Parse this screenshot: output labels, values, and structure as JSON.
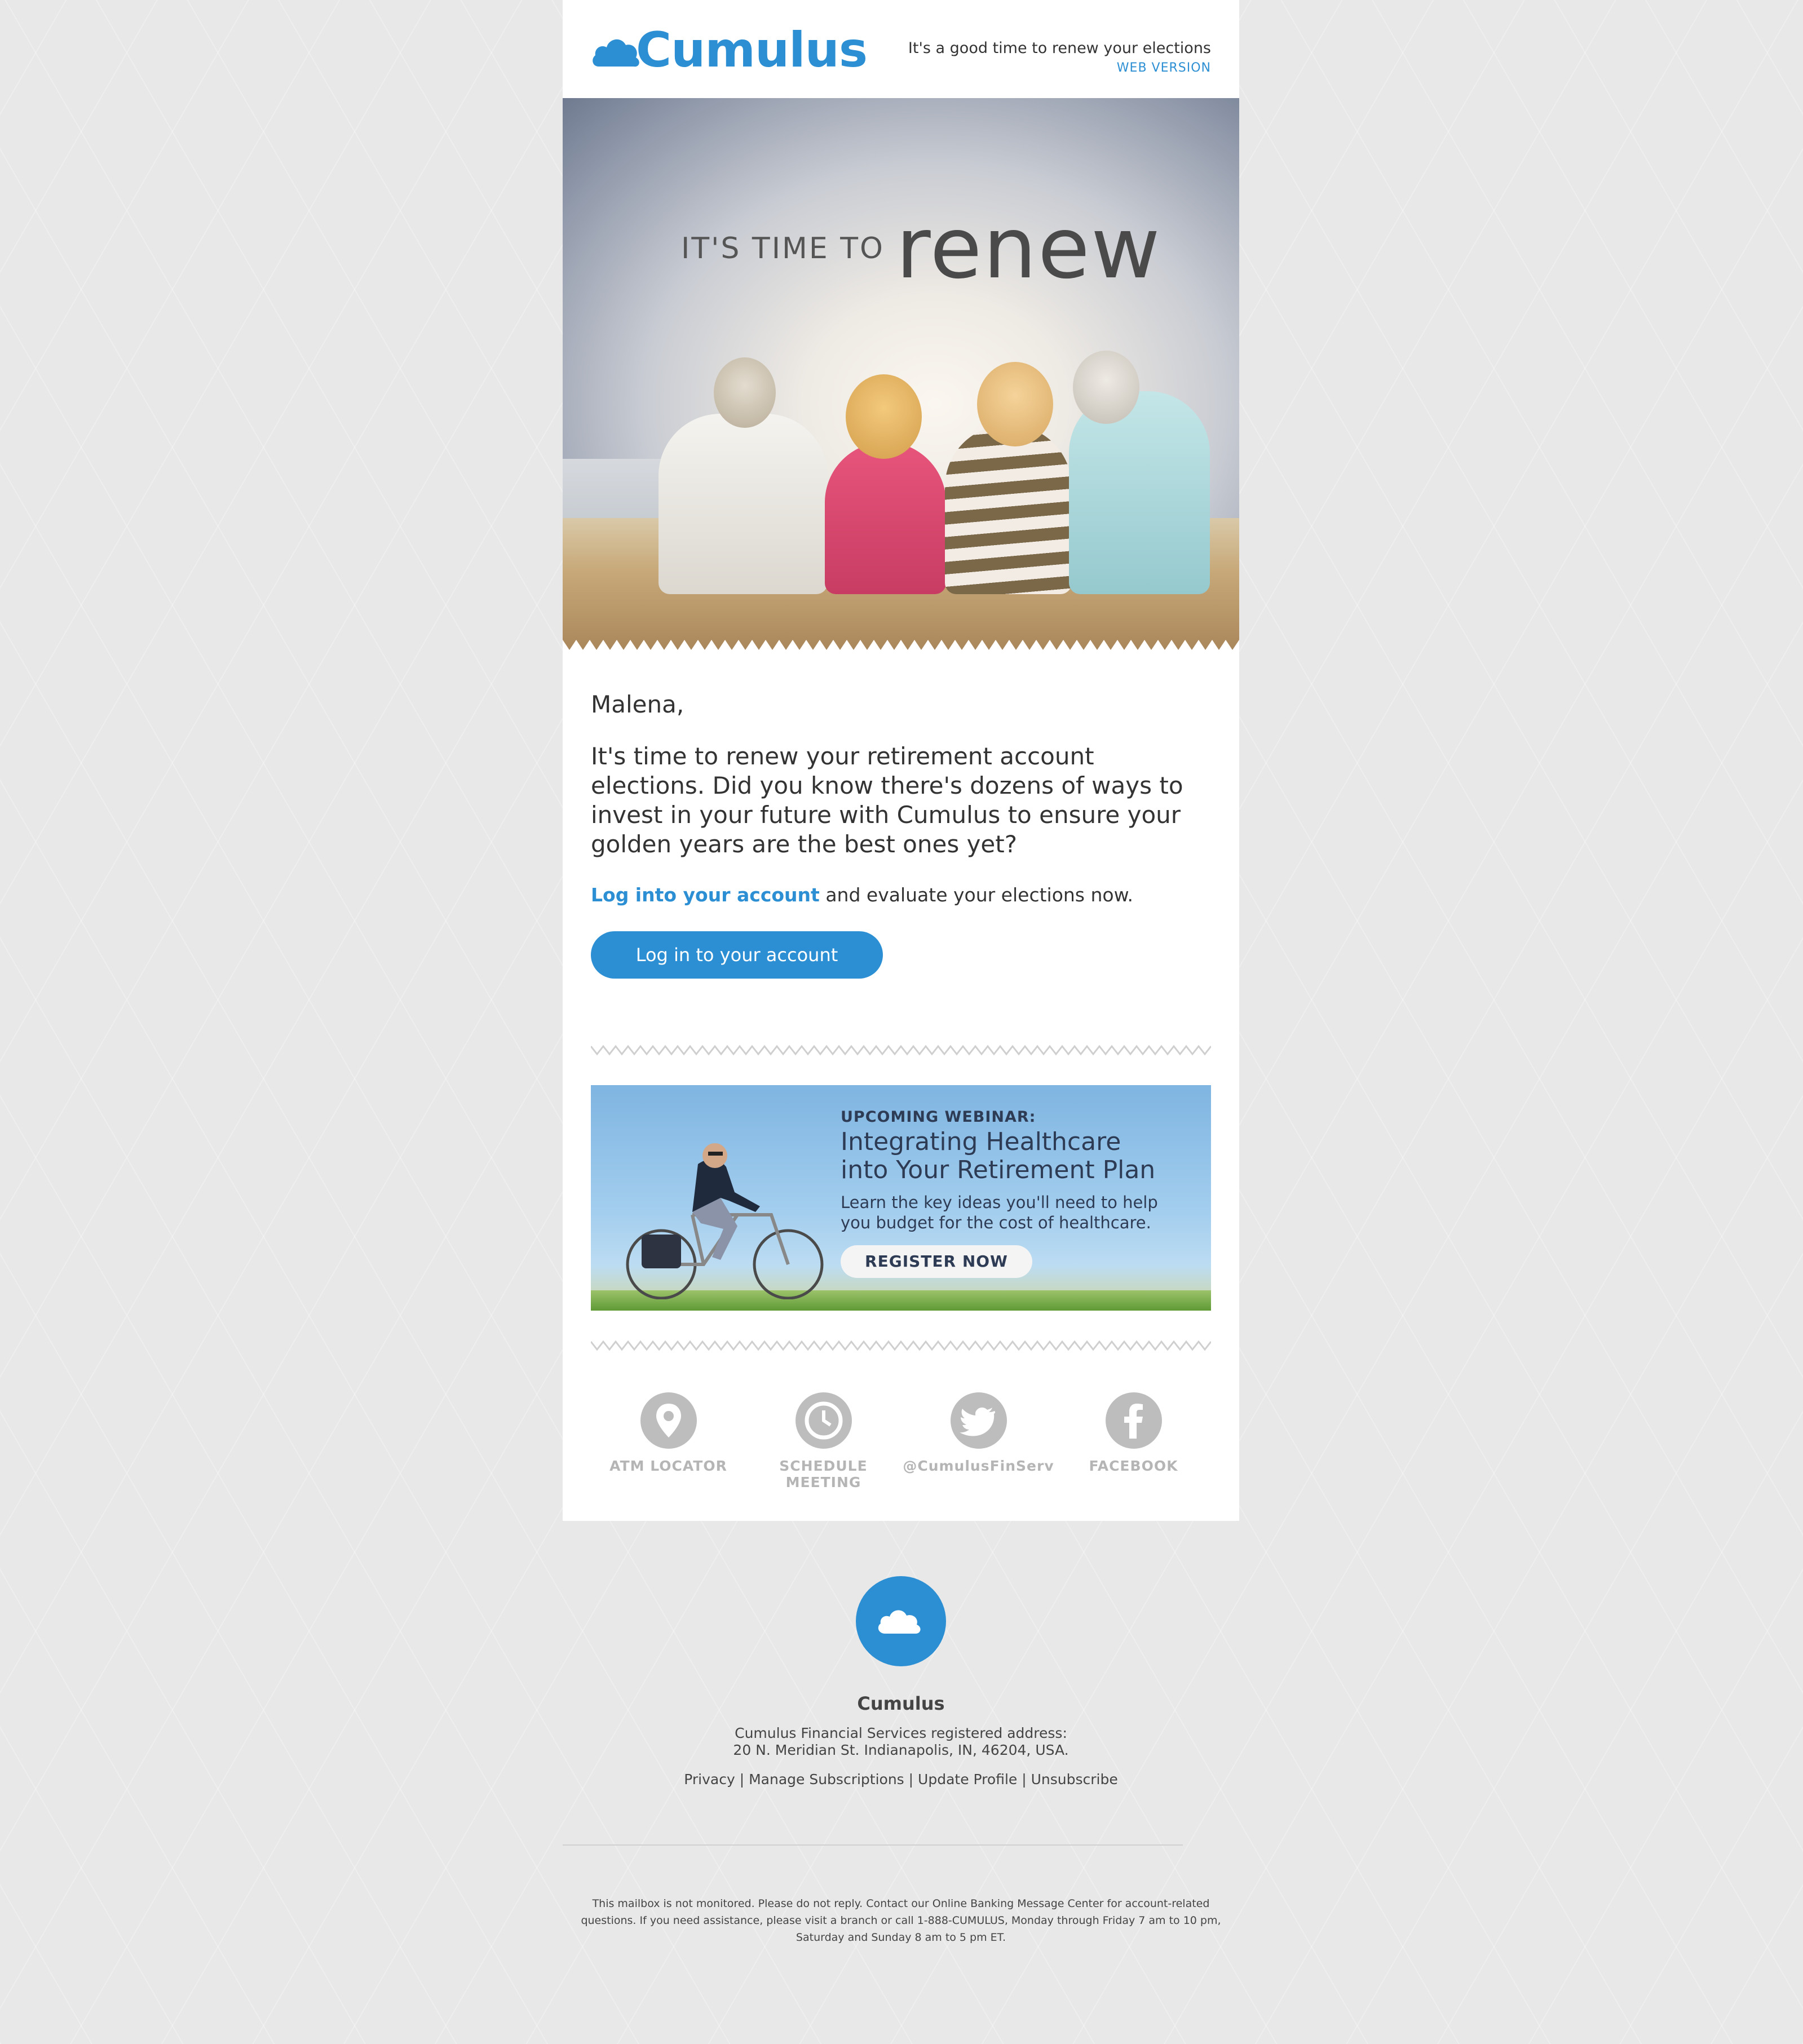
{
  "header": {
    "brand": "Cumulus",
    "tagline": "It's a good time to renew your elections",
    "web_version": "WEB VERSION"
  },
  "hero": {
    "title_small": "IT'S TIME TO",
    "title_big": "renew"
  },
  "body": {
    "greeting": "Malena,",
    "intro": "It's time to renew your retirement account elections. Did you know there's dozens of ways to invest in your future with Cumulus to ensure your golden years are the best ones yet?",
    "cta_link": "Log into your account",
    "cta_text": " and evaluate your elections now.",
    "cta_button": "Log in to your account"
  },
  "webinar": {
    "kicker": "UPCOMING WEBINAR:",
    "title_line1": "Integrating Healthcare",
    "title_line2": "into Your Retirement Plan",
    "body_line1": "Learn the key ideas you'll need to help",
    "body_line2": "you budget for the cost of healthcare.",
    "button": "REGISTER NOW"
  },
  "social": [
    {
      "label": "ATM LOCATOR",
      "icon": "map-pin-icon"
    },
    {
      "label": "SCHEDULE MEETING",
      "icon": "clock-icon"
    },
    {
      "label": "@CumulusFinServ",
      "icon": "twitter-icon"
    },
    {
      "label": "FACEBOOK",
      "icon": "facebook-icon"
    }
  ],
  "footer": {
    "name": "Cumulus",
    "address_line1": "Cumulus Financial Services registered address:",
    "address_line2": "20 N. Meridian St. Indianapolis, IN, 46204, USA.",
    "links": [
      "Privacy",
      "Manage Subscriptions",
      "Update Profile",
      "Unsubscribe"
    ],
    "separator": " | ",
    "disclaimer_line1": "This mailbox is not monitored. Please do not reply. Contact our Online Banking Message Center for account-related",
    "disclaimer_line2": "questions. If you need assistance, please visit a branch or call 1-888-CUMULUS, Monday through Friday 7 am to 10 pm,",
    "disclaimer_line3": "Saturday and Sunday 8 am to 5 pm ET."
  },
  "colors": {
    "accent": "#2c8fd3",
    "page_background": "#e8e8e8",
    "icon_gray": "#bdbdbd"
  }
}
